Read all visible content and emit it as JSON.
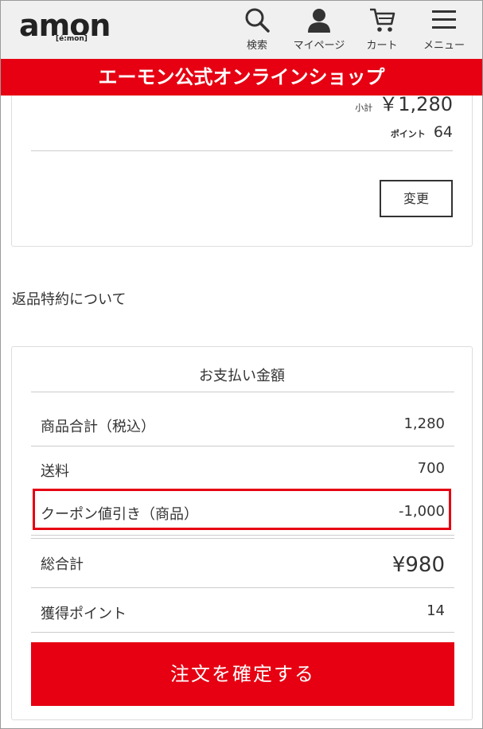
{
  "header": {
    "logo_text": "amon",
    "logo_sub": "[é:mon]",
    "nav": [
      {
        "label": "検索",
        "icon": "search-icon"
      },
      {
        "label": "マイページ",
        "icon": "user-icon"
      },
      {
        "label": "カート",
        "icon": "cart-icon"
      },
      {
        "label": "メニュー",
        "icon": "menu-icon"
      }
    ]
  },
  "banner": {
    "text": "エーモン公式オンラインショップ"
  },
  "cart_item": {
    "subtotal_label": "小計",
    "subtotal_value": "￥1,280",
    "point_label": "ポイント",
    "point_value": "64",
    "change_label": "変更"
  },
  "return_policy_link": "返品特約について",
  "payment": {
    "title": "お支払い金額",
    "rows": [
      {
        "label": "商品合計（税込）",
        "value": "1,280"
      },
      {
        "label": "送料",
        "value": "700"
      },
      {
        "label": "クーポン値引き（商品）",
        "value": "-1,000"
      }
    ],
    "total_label": "総合計",
    "total_value": "¥980",
    "points_label": "獲得ポイント",
    "points_value": "14",
    "confirm_label": "注文を確定する"
  },
  "colors": {
    "brand_red": "#e60012",
    "header_bg": "#f0f0f0"
  }
}
